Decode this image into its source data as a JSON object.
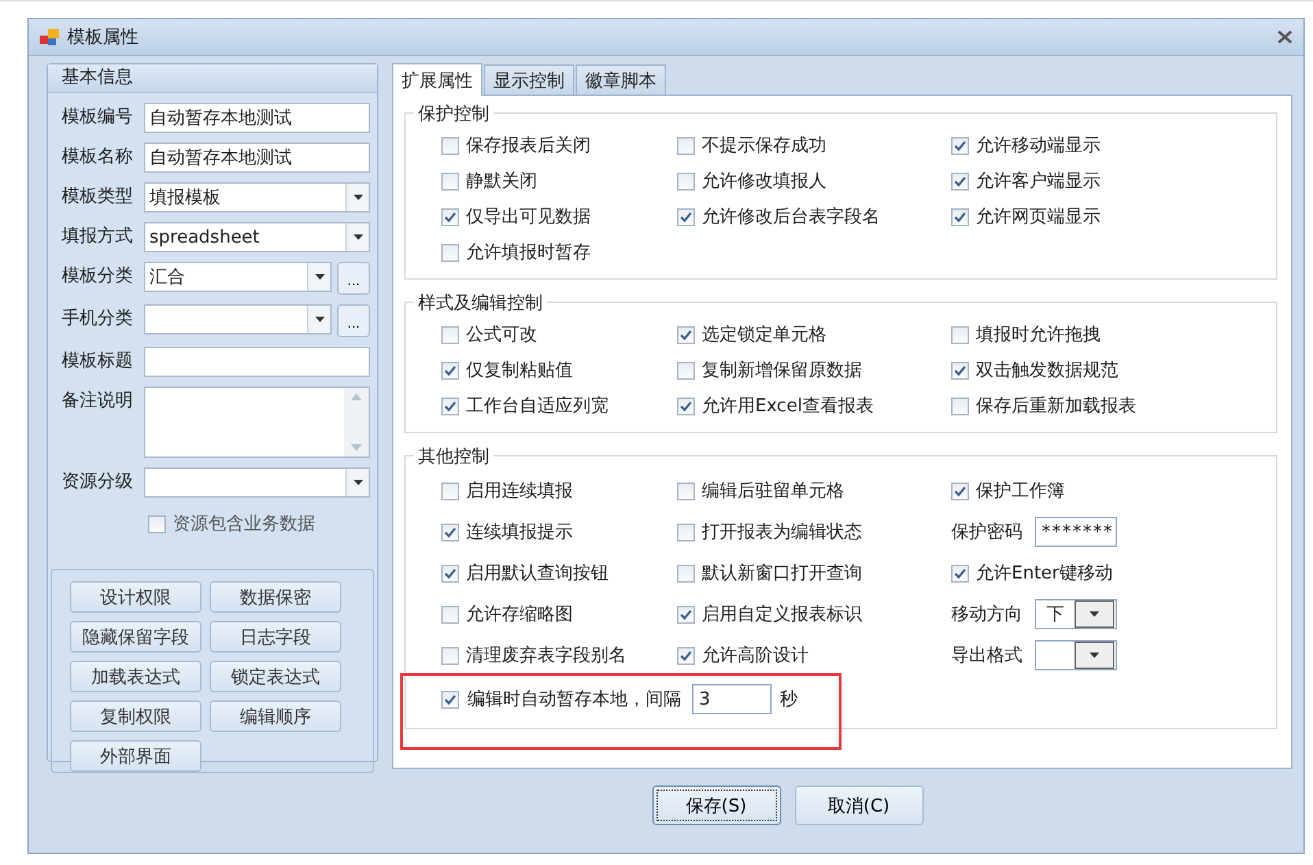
{
  "window": {
    "title": "模板属性"
  },
  "basic_info": {
    "title": "基本信息",
    "fields": [
      {
        "kind": "text",
        "label": "模板编号",
        "value": "自动暂存本地测试"
      },
      {
        "kind": "text",
        "label": "模板名称",
        "value": "自动暂存本地测试"
      },
      {
        "kind": "select",
        "label": "模板类型",
        "value": "填报模板"
      },
      {
        "kind": "select",
        "label": "填报方式",
        "value": "spreadsheet"
      },
      {
        "kind": "picker",
        "label": "模板分类",
        "value": "汇合",
        "more": "..."
      },
      {
        "kind": "picker",
        "label": "手机分类",
        "more": "..."
      },
      {
        "kind": "text",
        "label": "模板标题"
      },
      {
        "kind": "textarea",
        "label": "备注说明"
      },
      {
        "kind": "select",
        "label": "资源分级"
      }
    ],
    "checkbox": {
      "label": "资源包含业务数据",
      "checked": false
    },
    "buttons": [
      "设计权限",
      "数据保密",
      "隐藏保留字段",
      "日志字段",
      "加载表达式",
      "锁定表达式",
      "复制权限",
      "编辑顺序",
      "外部界面"
    ]
  },
  "tabs": [
    {
      "label": "扩展属性",
      "selected": true
    },
    {
      "label": "显示控制",
      "selected": false
    },
    {
      "label": "徽章脚本",
      "selected": false
    }
  ],
  "groups": [
    {
      "title": "保护控制",
      "columns": [
        [
          {
            "kind": "checkbox",
            "label": "保存报表后关闭",
            "checked": false
          },
          {
            "kind": "checkbox",
            "label": "静默关闭",
            "checked": false
          },
          {
            "kind": "checkbox",
            "label": "仅导出可见数据",
            "checked": true
          },
          {
            "kind": "checkbox",
            "label": "允许填报时暂存",
            "checked": false
          }
        ],
        [
          {
            "kind": "checkbox",
            "label": "不提示保存成功",
            "checked": false
          },
          {
            "kind": "checkbox",
            "label": "允许修改填报人",
            "checked": false
          },
          {
            "kind": "checkbox",
            "label": "允许修改后台表字段名",
            "checked": true
          }
        ],
        [
          {
            "kind": "checkbox",
            "label": "允许移动端显示",
            "checked": true
          },
          {
            "kind": "checkbox",
            "label": "允许客户端显示",
            "checked": true
          },
          {
            "kind": "checkbox",
            "label": "允许网页端显示",
            "checked": true
          }
        ]
      ]
    },
    {
      "title": "样式及编辑控制",
      "columns": [
        [
          {
            "kind": "checkbox",
            "label": "公式可改",
            "checked": false
          },
          {
            "kind": "checkbox",
            "label": "仅复制粘贴值",
            "checked": true
          },
          {
            "kind": "checkbox",
            "label": "工作台自适应列宽",
            "checked": true
          }
        ],
        [
          {
            "kind": "checkbox",
            "label": "选定锁定单元格",
            "checked": true
          },
          {
            "kind": "checkbox",
            "label": "复制新增保留原数据",
            "checked": false
          },
          {
            "kind": "checkbox",
            "label": "允许用Excel查看报表",
            "checked": true
          }
        ],
        [
          {
            "kind": "checkbox",
            "label": "填报时允许拖拽",
            "checked": false
          },
          {
            "kind": "checkbox",
            "label": "双击触发数据规范",
            "checked": true
          },
          {
            "kind": "checkbox",
            "label": "保存后重新加载报表",
            "checked": false
          }
        ]
      ]
    },
    {
      "title": "其他控制",
      "columns": [
        [
          {
            "kind": "checkbox",
            "label": "启用连续填报",
            "checked": false
          },
          {
            "kind": "checkbox",
            "label": "连续填报提示",
            "checked": true
          },
          {
            "kind": "checkbox",
            "label": "启用默认查询按钮",
            "checked": true
          },
          {
            "kind": "checkbox",
            "label": "允许存缩略图",
            "checked": false
          },
          {
            "kind": "checkbox",
            "label": "清理废弃表字段别名",
            "checked": false
          }
        ],
        [
          {
            "kind": "checkbox",
            "label": "编辑后驻留单元格",
            "checked": false
          },
          {
            "kind": "checkbox",
            "label": "打开报表为编辑状态",
            "checked": false
          },
          {
            "kind": "checkbox",
            "label": "默认新窗口打开查询",
            "checked": false
          },
          {
            "kind": "checkbox",
            "label": "启用自定义报表标识",
            "checked": true
          },
          {
            "kind": "checkbox",
            "label": "允许高阶设计",
            "checked": true
          }
        ],
        [
          {
            "kind": "checkbox",
            "label": "保护工作簿",
            "checked": true
          },
          {
            "kind": "password",
            "label": "保护密码",
            "value": "*******"
          },
          {
            "kind": "checkbox",
            "label": "允许Enter键移动",
            "checked": true
          },
          {
            "kind": "select",
            "label": "移动方向",
            "value": "下"
          },
          {
            "kind": "select",
            "label": "导出格式"
          }
        ]
      ],
      "footer": {
        "label": "编辑时自动暂存本地，间隔",
        "checked": true,
        "value": "3",
        "unit": "秒",
        "annotated": true
      }
    }
  ],
  "buttons": [
    {
      "label": "保存(S)",
      "default": true
    },
    {
      "label": "取消(C)",
      "default": false
    }
  ]
}
